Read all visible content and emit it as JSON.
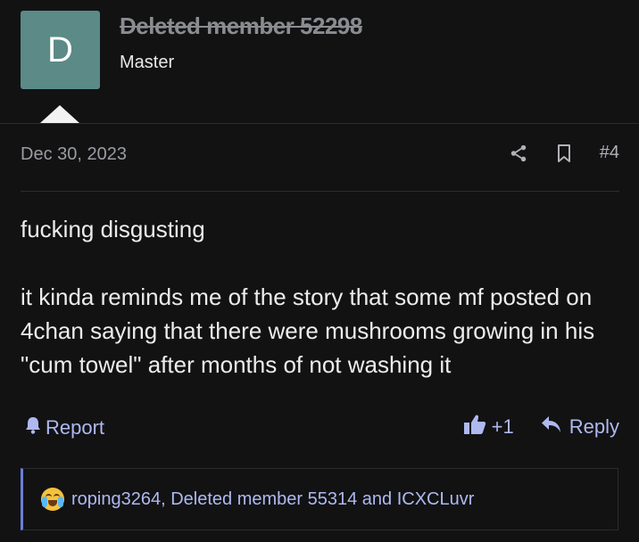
{
  "user": {
    "avatar_letter": "D",
    "name": "Deleted member 52298",
    "title": "Master",
    "avatar_color": "#5b8a87"
  },
  "post": {
    "date": "Dec 30, 2023",
    "number": "#4",
    "paragraphs": [
      "fucking disgusting",
      "it kinda reminds me of the story that some mf posted on 4chan saying that there were mushrooms growing in his \"cum towel\" after months of not washing it"
    ]
  },
  "actions": {
    "report_label": "Report",
    "like_count": "+1",
    "reply_label": "Reply",
    "share_icon": "share-icon",
    "bookmark_icon": "bookmark-icon"
  },
  "reactions": {
    "emoji": "crying-laughing-emoji",
    "users_text": "roping3264, Deleted member 55314 and ICXCLuvr"
  },
  "colors": {
    "background": "#121213",
    "link": "#aeb9f0",
    "accent": "#6b7fd9"
  }
}
